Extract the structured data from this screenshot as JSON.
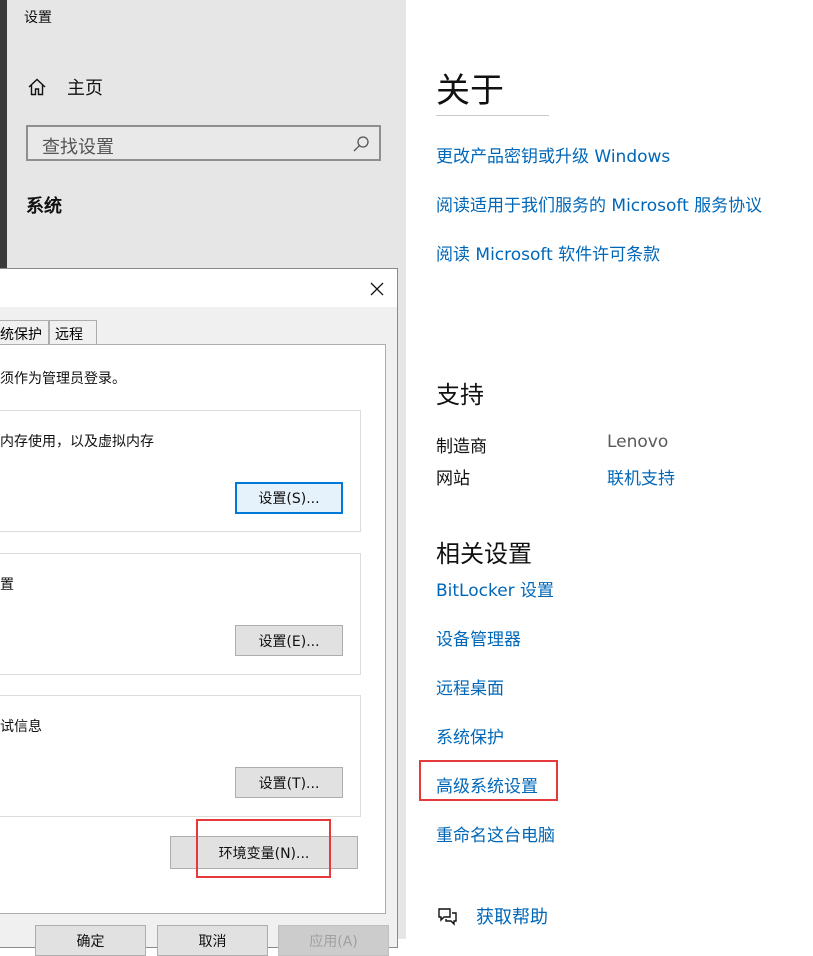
{
  "nav": {
    "window_title": "设置",
    "home_label": "主页",
    "search_placeholder": "查找设置",
    "section_label": "系统"
  },
  "about": {
    "title": "关于",
    "links": [
      "更改产品密钥或升级 Windows",
      "阅读适用于我们服务的 Microsoft 服务协议",
      "阅读 Microsoft 软件许可条款"
    ]
  },
  "support": {
    "title": "支持",
    "manufacturer_label": "制造商",
    "manufacturer_value": "Lenovo",
    "website_label": "网站",
    "website_value": "联机支持"
  },
  "related": {
    "title": "相关设置",
    "links": [
      "BitLocker 设置",
      "设备管理器",
      "远程桌面",
      "系统保护",
      "高级系统设置",
      "重命名这台电脑"
    ]
  },
  "help_label": "获取帮助",
  "dialog": {
    "tabs": [
      "统保护",
      "远程"
    ],
    "intro_text": "须作为管理员登录。",
    "groups": [
      {
        "text": "内存使用，以及虚拟内存",
        "button": "设置(S)..."
      },
      {
        "text": "置",
        "button": "设置(E)..."
      },
      {
        "text": "试信息",
        "button": "设置(T)..."
      }
    ],
    "env_button": "环境变量(N)...",
    "footer_buttons": [
      "确定",
      "取消",
      "应用(A)"
    ]
  },
  "colors": {
    "link": "#0067b8",
    "highlight_box": "#e6393c",
    "focus_border": "#0078d7"
  }
}
